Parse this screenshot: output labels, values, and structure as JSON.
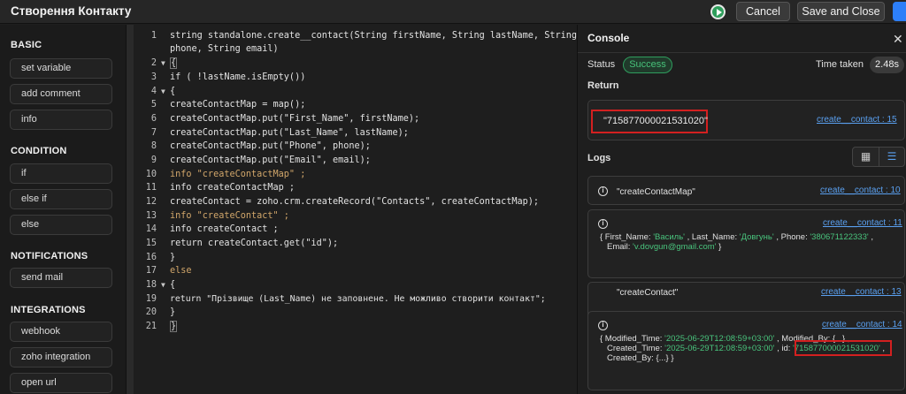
{
  "header": {
    "title": "Створення Контакту",
    "cancel_label": "Cancel",
    "save_label": "Save and Close"
  },
  "sidebar": {
    "sections": [
      {
        "title": "BASIC",
        "items": [
          "set variable",
          "add comment",
          "info"
        ]
      },
      {
        "title": "CONDITION",
        "items": [
          "if",
          "else if",
          "else"
        ]
      },
      {
        "title": "NOTIFICATIONS",
        "items": [
          "send mail"
        ]
      },
      {
        "title": "INTEGRATIONS",
        "items": [
          "webhook",
          "zoho integration",
          "open url"
        ]
      }
    ]
  },
  "editor": {
    "lines": [
      {
        "n": "1",
        "text": "string standalone.create__contact(String firstName, String lastName, String"
      },
      {
        "n": "",
        "text": "phone, String email)"
      },
      {
        "n": "2",
        "text": "{"
      },
      {
        "n": "3",
        "text": "if ( !lastName.isEmpty())"
      },
      {
        "n": "4",
        "text": "{"
      },
      {
        "n": "5",
        "text": "createContactMap = map();"
      },
      {
        "n": "6",
        "text": "createContactMap.put(\"First_Name\", firstName);"
      },
      {
        "n": "7",
        "text": "createContactMap.put(\"Last_Name\", lastName);"
      },
      {
        "n": "8",
        "text": "createContactMap.put(\"Phone\", phone);"
      },
      {
        "n": "9",
        "text": "createContactMap.put(\"Email\", email);"
      },
      {
        "n": "10",
        "text": "info \"createContactMap\" ;"
      },
      {
        "n": "11",
        "text": "info createContactMap ;"
      },
      {
        "n": "12",
        "text": "createContact = zoho.crm.createRecord(\"Contacts\", createContactMap);"
      },
      {
        "n": "13",
        "text": "info \"createContact\" ;"
      },
      {
        "n": "14",
        "text": "info createContact ;"
      },
      {
        "n": "15",
        "text": "return createContact.get(\"id\");"
      },
      {
        "n": "16",
        "text": "}"
      },
      {
        "n": "17",
        "text": "else"
      },
      {
        "n": "18",
        "text": "{"
      },
      {
        "n": "19",
        "text": "return \"Прізвище (Last_Name) не заповнене. Не можливо створити контакт\";"
      },
      {
        "n": "20",
        "text": "}"
      },
      {
        "n": "21",
        "text": "}"
      }
    ]
  },
  "console": {
    "title": "Console",
    "status_label": "Status",
    "status_value": "Success",
    "time_label": "Time taken",
    "time_value": "2.48s",
    "return_label": "Return",
    "return_value": "\"715877000021531020\"",
    "return_link": "create__contact : 15",
    "logs_label": "Logs",
    "logs": [
      {
        "link": "create__contact : 10",
        "text": "\"createContactMap\""
      },
      {
        "link": "create__contact : 11",
        "line1_pre": "{ First_Name: ",
        "v1": "'Василь'",
        "line1_mid": " , Last_Name: ",
        "v2": "'Довгунь'",
        "line1_mid2": " , Phone: ",
        "v3": "'380671122333'",
        "line1_end": " ,",
        "line2_pre": "Email: ",
        "v4": "'v.dovgun@gmail.com'",
        "line2_end": " }"
      },
      {
        "link": "create__contact : 13",
        "text": "\"createContact\""
      },
      {
        "link": "create__contact : 14",
        "line1_pre": "{ Modified_Time: ",
        "v1": "'2025-06-29T12:08:59+03:00'",
        "line1_end": " , Modified_By: {...} ,",
        "line2_pre": "Created_Time: ",
        "v2": "'2025-06-29T12:08:59+03:00'",
        "line2_mid": " , id: ",
        "v3": "'715877000021531020'",
        "line2_end": " ,",
        "line3": "Created_By: {...} }"
      }
    ]
  },
  "colors": {
    "accent": "#2d7ff9",
    "success": "#47c27a",
    "highlight": "#d32020",
    "link": "#5aa0f0"
  },
  "icons": {
    "run": "play-circle-icon",
    "close": "close-icon",
    "grid": "grid-view-icon",
    "list": "list-view-icon",
    "info": "info-icon"
  }
}
